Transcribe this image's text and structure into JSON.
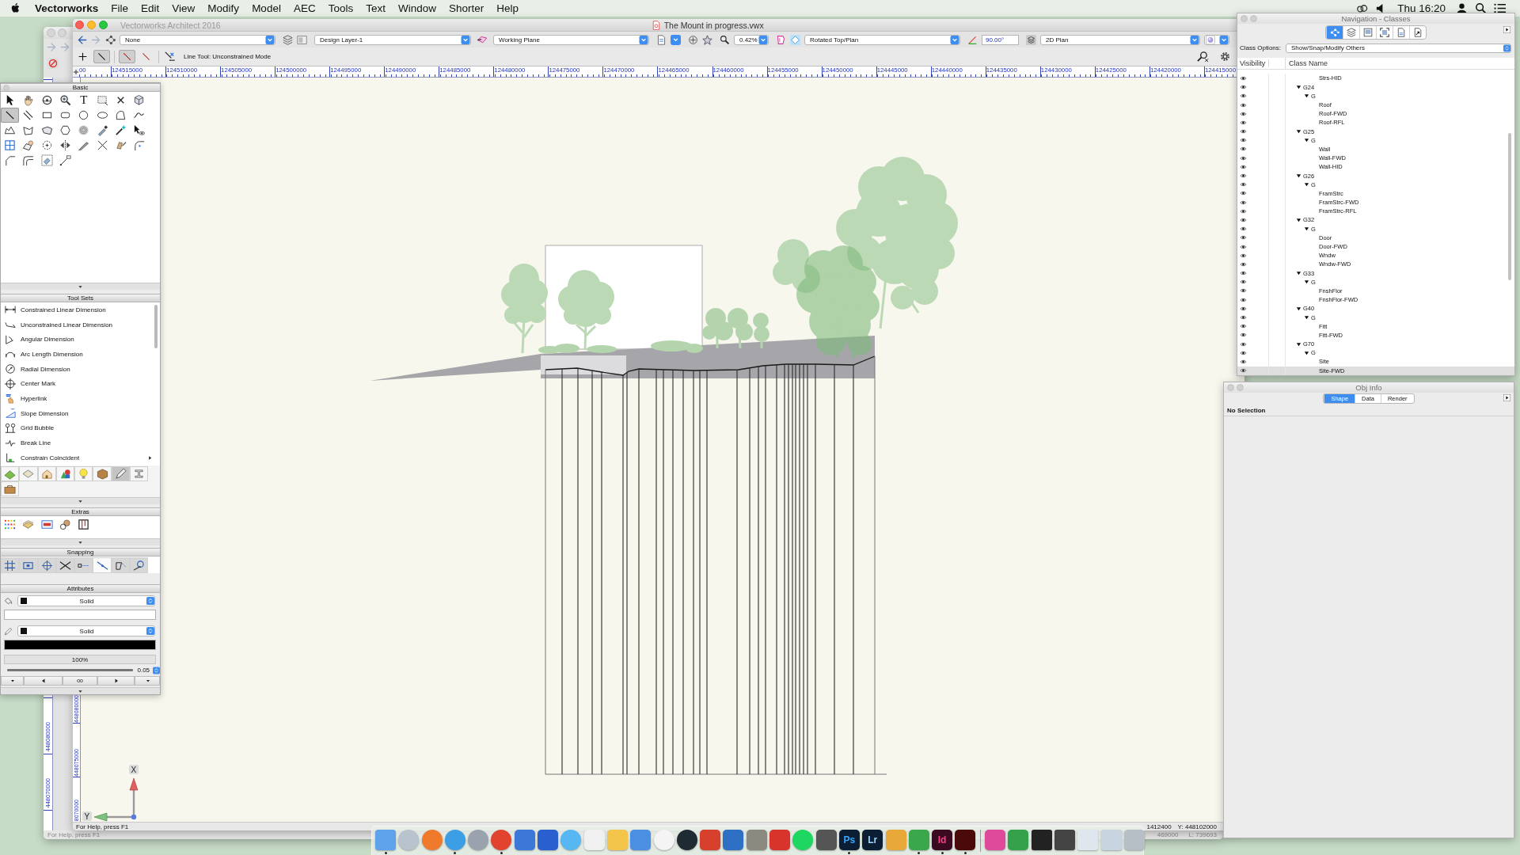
{
  "menu_bar": {
    "app": "Vectorworks",
    "items": [
      "File",
      "Edit",
      "View",
      "Modify",
      "Model",
      "AEC",
      "Tools",
      "Text",
      "Window",
      "Shorter",
      "Help"
    ],
    "clock": "Thu 16:20"
  },
  "back_window": {
    "ruler_labels": [
      "448080000",
      "448070000"
    ],
    "status": "For Help, press F1",
    "readout_1": "469000",
    "readout_2": "L: 739693"
  },
  "main_window": {
    "app_title": "Vectorworks Architect 2016",
    "document_title": "The Mount in progress.vwx",
    "view_bar": {
      "active_class": "None",
      "active_layer": "Design Layer-1",
      "working_plane": "Working Plane",
      "zoom": "0.42%",
      "view": "Rotated Top/Plan",
      "rotation": "90.00°",
      "render_mode": "2D Plan"
    },
    "mode_bar": {
      "modes": [
        {
          "selected": false
        },
        {
          "selected": true
        },
        {
          "selected": true
        },
        {
          "selected": false
        }
      ],
      "hint": "Line Tool: Unconstrained Mode"
    },
    "ruler": {
      "x_labels": [
        "00",
        "124515000",
        "124510000",
        "124505000",
        "124500000",
        "124495000",
        "124490000",
        "124485000",
        "124480000",
        "124475000",
        "124470000",
        "124465000",
        "124460000",
        "124455000",
        "124450000",
        "124445000",
        "124440000",
        "124435000",
        "124430000",
        "124425000",
        "124420000",
        "124415000"
      ],
      "y_labels": [
        "448080000",
        "448075000",
        "8070000"
      ]
    },
    "canvas": {
      "axis_x": "X",
      "axis_y": "Y"
    },
    "status_bar": {
      "help": "For Help, press F1",
      "x_readout": "1412400",
      "y_readout": "Y: 448102000"
    }
  },
  "tool_palette": {
    "basic": {
      "title": "Basic",
      "tools": [
        {
          "kind": "pointer",
          "selected": false
        },
        {
          "kind": "hand",
          "selected": false
        },
        {
          "kind": "orbit",
          "selected": false
        },
        {
          "kind": "zoom",
          "selected": false
        },
        {
          "kind": "glyph",
          "glyph": "T",
          "selected": false
        },
        {
          "kind": "marquee",
          "selected": false
        },
        {
          "kind": "cross",
          "selected": false
        },
        {
          "kind": "cube",
          "selected": false
        },
        {
          "kind": "line",
          "selected": true
        },
        {
          "kind": "double-line",
          "selected": false
        },
        {
          "kind": "rectangle",
          "selected": false
        },
        {
          "kind": "rounded-rectangle",
          "selected": false
        },
        {
          "kind": "circle",
          "selected": false
        },
        {
          "kind": "oval",
          "selected": false
        },
        {
          "kind": "arc",
          "selected": false
        },
        {
          "kind": "curve",
          "selected": false
        },
        {
          "kind": "polyline",
          "selected": false
        },
        {
          "kind": "polygon",
          "selected": false
        },
        {
          "kind": "plane",
          "selected": false
        },
        {
          "kind": "hexagon",
          "selected": false
        },
        {
          "kind": "concentric-rings",
          "selected": false
        },
        {
          "kind": "eyedropper",
          "selected": false
        },
        {
          "kind": "wand",
          "selected": false
        },
        {
          "kind": "pointer-eye",
          "selected": false
        },
        {
          "kind": "grid",
          "selected": false
        },
        {
          "kind": "stamp",
          "selected": false
        },
        {
          "kind": "dashed-circle",
          "selected": false
        },
        {
          "kind": "mirror",
          "selected": false
        },
        {
          "kind": "knife",
          "selected": false
        },
        {
          "kind": "x-lines",
          "selected": false
        },
        {
          "kind": "hand-blade",
          "selected": false
        },
        {
          "kind": "rounded-corner",
          "selected": false
        },
        {
          "kind": "cut-corner",
          "selected": false
        },
        {
          "kind": "parallel-curves",
          "selected": false
        },
        {
          "kind": "eraser",
          "selected": false
        },
        {
          "kind": "connector",
          "selected": false
        }
      ]
    },
    "tool_sets": {
      "title": "Tool Sets",
      "items": [
        "Constrained Linear Dimension",
        "Unconstrained Linear Dimension",
        "Angular Dimension",
        "Arc Length Dimension",
        "Radial Dimension",
        "Center Mark",
        "Hyperlink",
        "Slope Dimension",
        "Grid Bubble",
        "Break Line",
        "Constrain Coincident"
      ],
      "sets": [
        {
          "selected": false
        },
        {
          "selected": false
        },
        {
          "selected": false
        },
        {
          "selected": false
        },
        {
          "selected": false
        },
        {
          "selected": false
        },
        {
          "selected": true
        },
        {
          "selected": false
        },
        {
          "selected": false
        }
      ]
    },
    "extras": {
      "title": "Extras"
    },
    "snapping": {
      "title": "Snapping",
      "modes": [
        {
          "on": true
        },
        {
          "on": true
        },
        {
          "on": true
        },
        {
          "on": true
        },
        {
          "on": true
        },
        {
          "on": false
        },
        {
          "on": true
        },
        {
          "on": true
        }
      ]
    },
    "attributes": {
      "title": "Attributes",
      "fill": {
        "style": "Solid",
        "color": "#ffffff"
      },
      "pen": {
        "style": "Solid",
        "color": "#000000"
      },
      "opacity": "100%",
      "line_weight": "0.05"
    }
  },
  "nav_palette": {
    "title": "Navigation - Classes",
    "tabs": [
      {
        "selected": true
      },
      {
        "selected": false
      },
      {
        "selected": false
      },
      {
        "selected": false
      },
      {
        "selected": false
      },
      {
        "selected": false
      }
    ],
    "options_label": "Class Options:",
    "options_value": "Show/Snap/Modify Others",
    "columns": [
      "Visibility",
      "Class Name"
    ],
    "classes": [
      {
        "children": [
          {
            "children": [
              {
                "name": "Strs-HID",
                "selected": false
              }
            ]
          }
        ]
      },
      {
        "name": "G24",
        "expanded": true,
        "selected": false,
        "children": [
          {
            "name": "G",
            "expanded": true,
            "selected": false,
            "children": [
              {
                "name": "Roof",
                "selected": false
              },
              {
                "name": "Roof-FWD",
                "selected": false
              },
              {
                "name": "Roof-RFL",
                "selected": false
              }
            ]
          }
        ]
      },
      {
        "name": "G25",
        "expanded": true,
        "selected": false,
        "children": [
          {
            "name": "G",
            "expanded": true,
            "selected": false,
            "children": [
              {
                "name": "Wall",
                "selected": false
              },
              {
                "name": "Wall-FWD",
                "selected": false
              },
              {
                "name": "Wall-HID",
                "selected": false
              }
            ]
          }
        ]
      },
      {
        "name": "G26",
        "expanded": true,
        "selected": false,
        "children": [
          {
            "name": "G",
            "expanded": true,
            "selected": false,
            "children": [
              {
                "name": "FramStrc",
                "selected": false
              },
              {
                "name": "FramStrc-FWD",
                "selected": false
              },
              {
                "name": "FramStrc-RFL",
                "selected": false
              }
            ]
          }
        ]
      },
      {
        "name": "G32",
        "expanded": true,
        "selected": false,
        "children": [
          {
            "name": "G",
            "expanded": true,
            "selected": false,
            "children": [
              {
                "name": "Door",
                "selected": false
              },
              {
                "name": "Door-FWD",
                "selected": false
              },
              {
                "name": "Wndw",
                "selected": false
              },
              {
                "name": "Wndw-FWD",
                "selected": false
              }
            ]
          }
        ]
      },
      {
        "name": "G33",
        "expanded": true,
        "selected": false,
        "children": [
          {
            "name": "G",
            "expanded": true,
            "selected": false,
            "children": [
              {
                "name": "FnshFlor",
                "selected": false
              },
              {
                "name": "FnshFlor-FWD",
                "selected": false
              }
            ]
          }
        ]
      },
      {
        "name": "G40",
        "expanded": true,
        "selected": false,
        "children": [
          {
            "name": "G",
            "expanded": true,
            "selected": false,
            "children": [
              {
                "name": "Fitt",
                "selected": false
              },
              {
                "name": "Fitt-FWD",
                "selected": false
              }
            ]
          }
        ]
      },
      {
        "name": "G70",
        "expanded": true,
        "selected": false,
        "children": [
          {
            "name": "G",
            "expanded": true,
            "selected": false,
            "children": [
              {
                "name": "Site",
                "selected": false
              },
              {
                "name": "Site-FWD",
                "selected": true
              }
            ]
          }
        ]
      }
    ]
  },
  "obj_info": {
    "title": "Obj Info",
    "tabs": [
      {
        "label": "Shape",
        "selected": true
      },
      {
        "label": "Data",
        "selected": false
      },
      {
        "label": "Render",
        "selected": false
      }
    ],
    "message": "No Selection"
  },
  "dock": {
    "apps": [
      {
        "kind": "app",
        "running": true
      },
      {
        "kind": "app",
        "running": false
      },
      {
        "kind": "app",
        "running": false
      },
      {
        "kind": "app",
        "running": true
      },
      {
        "kind": "app",
        "running": false
      },
      {
        "kind": "app",
        "running": true
      },
      {
        "kind": "app",
        "running": false
      },
      {
        "kind": "app",
        "running": false
      },
      {
        "kind": "app",
        "running": false
      },
      {
        "kind": "app",
        "running": false
      },
      {
        "kind": "app",
        "running": false
      },
      {
        "kind": "app",
        "running": false
      },
      {
        "kind": "app",
        "running": false
      },
      {
        "kind": "app",
        "running": false
      },
      {
        "kind": "app",
        "running": false
      },
      {
        "kind": "app",
        "running": false
      },
      {
        "kind": "app",
        "running": false
      },
      {
        "kind": "app",
        "running": false
      },
      {
        "kind": "app",
        "running": false
      },
      {
        "kind": "app",
        "running": false
      },
      {
        "kind": "app",
        "label": "Ps",
        "running": true
      },
      {
        "kind": "app",
        "label": "Lr",
        "running": false
      },
      {
        "kind": "app",
        "running": false
      },
      {
        "kind": "app",
        "running": true
      },
      {
        "kind": "app",
        "label": "Id",
        "running": true
      },
      {
        "kind": "app",
        "running": true
      },
      {
        "kind": "separator"
      },
      {
        "kind": "app",
        "running": false
      },
      {
        "kind": "app",
        "running": false
      },
      {
        "kind": "app",
        "running": false
      },
      {
        "kind": "app",
        "running": false
      },
      {
        "kind": "app",
        "running": false
      },
      {
        "kind": "app",
        "running": false
      },
      {
        "kind": "app",
        "running": false
      }
    ]
  }
}
